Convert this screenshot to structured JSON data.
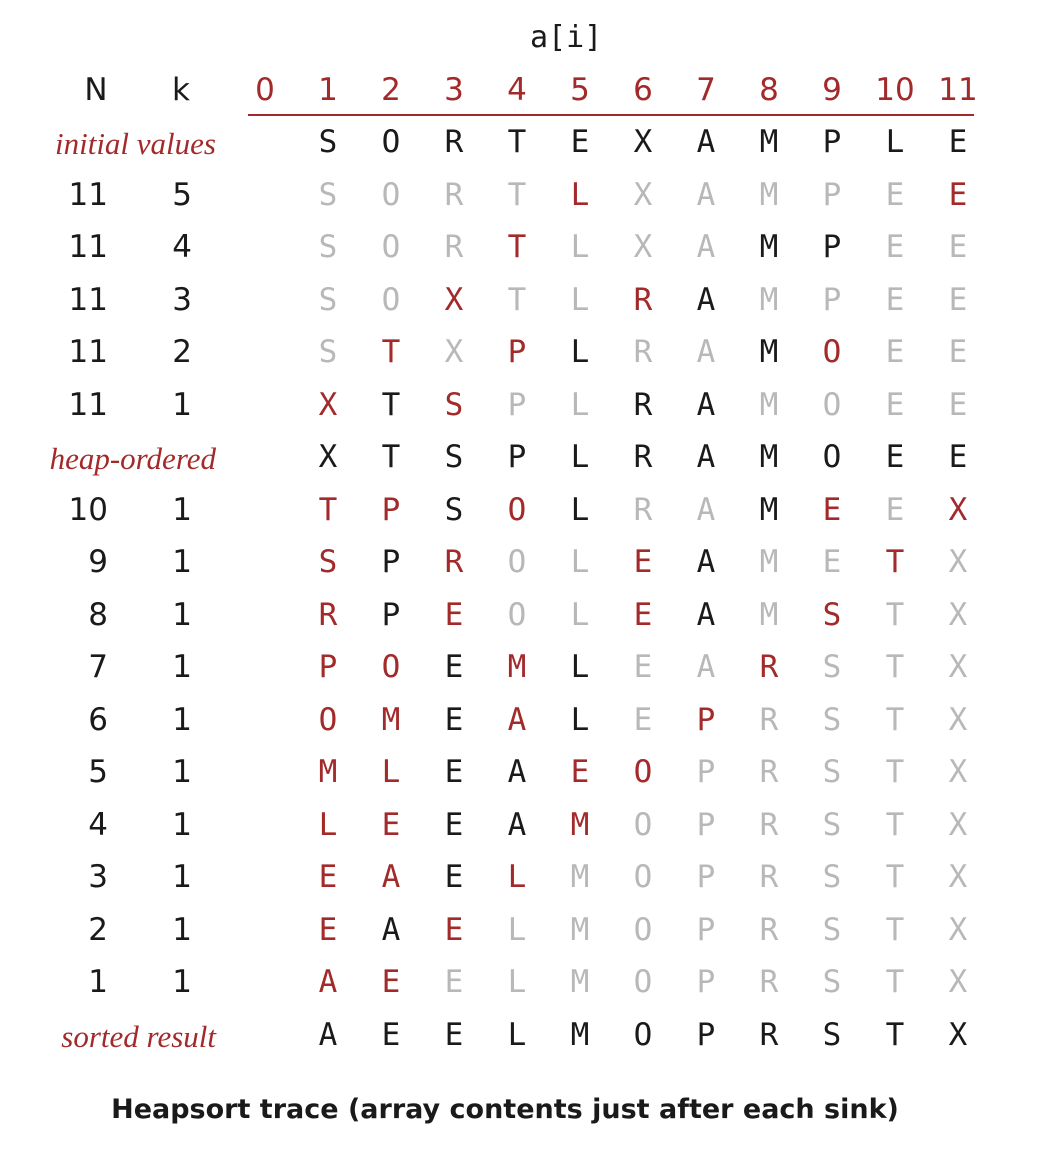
{
  "title": "a[i]",
  "headers": {
    "n": "N",
    "k": "k"
  },
  "indices": [
    "0",
    "1",
    "2",
    "3",
    "4",
    "5",
    "6",
    "7",
    "8",
    "9",
    "10",
    "11"
  ],
  "rows": [
    {
      "label": "initial values",
      "n": "",
      "k": "",
      "cells": [
        "S",
        "O",
        "R",
        "T",
        "E",
        "X",
        "A",
        "M",
        "P",
        "L",
        "E"
      ],
      "styles": "bbbbbbbbbbb"
    },
    {
      "label": "",
      "n": "11",
      "k": "5",
      "cells": [
        "S",
        "O",
        "R",
        "T",
        "L",
        "X",
        "A",
        "M",
        "P",
        "E",
        "E"
      ],
      "styles": "ggggrgggg rb"
    },
    {
      "label": "",
      "n": "11",
      "k": "4",
      "cells": [
        "S",
        "O",
        "R",
        "T",
        "L",
        "X",
        "A",
        "M",
        "P",
        "E",
        "E"
      ],
      "styles": "gggrgggbbgg"
    },
    {
      "label": "",
      "n": "11",
      "k": "3",
      "cells": [
        "S",
        "O",
        "X",
        "T",
        "L",
        "R",
        "A",
        "M",
        "P",
        "E",
        "E"
      ],
      "styles": "ggrggrbgggg"
    },
    {
      "label": "",
      "n": "11",
      "k": "2",
      "cells": [
        "S",
        "T",
        "X",
        "P",
        "L",
        "R",
        "A",
        "M",
        "O",
        "E",
        "E"
      ],
      "styles": "grgrbggbrgg"
    },
    {
      "label": "",
      "n": "11",
      "k": "1",
      "cells": [
        "X",
        "T",
        "S",
        "P",
        "L",
        "R",
        "A",
        "M",
        "O",
        "E",
        "E"
      ],
      "styles": "rbrggbbgggg"
    },
    {
      "label": "heap-ordered",
      "n": "",
      "k": "",
      "cells": [
        "X",
        "T",
        "S",
        "P",
        "L",
        "R",
        "A",
        "M",
        "O",
        "E",
        "E"
      ],
      "styles": "bbbbbbbbbbb"
    },
    {
      "label": "",
      "n": "10",
      "k": "1",
      "cells": [
        "T",
        "P",
        "S",
        "O",
        "L",
        "R",
        "A",
        "M",
        "E",
        "E",
        "X"
      ],
      "styles": "rrbrbggbrgr"
    },
    {
      "label": "",
      "n": "9",
      "k": "1",
      "cells": [
        "S",
        "P",
        "R",
        "O",
        "L",
        "E",
        "A",
        "M",
        "E",
        "T",
        "X"
      ],
      "styles": "rbrggrbggrg"
    },
    {
      "label": "",
      "n": "8",
      "k": "1",
      "cells": [
        "R",
        "P",
        "E",
        "O",
        "L",
        "E",
        "A",
        "M",
        "S",
        "T",
        "X"
      ],
      "styles": "rbrggrbgrgg"
    },
    {
      "label": "",
      "n": "7",
      "k": "1",
      "cells": [
        "P",
        "O",
        "E",
        "M",
        "L",
        "E",
        "A",
        "R",
        "S",
        "T",
        "X"
      ],
      "styles": "rrbrbggrggg"
    },
    {
      "label": "",
      "n": "6",
      "k": "1",
      "cells": [
        "O",
        "M",
        "E",
        "A",
        "L",
        "E",
        "P",
        "R",
        "S",
        "T",
        "X"
      ],
      "styles": "rrbrbgrgggg"
    },
    {
      "label": "",
      "n": "5",
      "k": "1",
      "cells": [
        "M",
        "L",
        "E",
        "A",
        "E",
        "O",
        "P",
        "R",
        "S",
        "T",
        "X"
      ],
      "styles": "rrbbrrggggg"
    },
    {
      "label": "",
      "n": "4",
      "k": "1",
      "cells": [
        "L",
        "E",
        "E",
        "A",
        "M",
        "O",
        "P",
        "R",
        "S",
        "T",
        "X"
      ],
      "styles": "rrbbrgggggg"
    },
    {
      "label": "",
      "n": "3",
      "k": "1",
      "cells": [
        "E",
        "A",
        "E",
        "L",
        "M",
        "O",
        "P",
        "R",
        "S",
        "T",
        "X"
      ],
      "styles": "rrbrggggggg"
    },
    {
      "label": "",
      "n": "2",
      "k": "1",
      "cells": [
        "E",
        "A",
        "E",
        "L",
        "M",
        "O",
        "P",
        "R",
        "S",
        "T",
        "X"
      ],
      "styles": "rbrgggggggg"
    },
    {
      "label": "",
      "n": "1",
      "k": "1",
      "cells": [
        "A",
        "E",
        "E",
        "L",
        "M",
        "O",
        "P",
        "R",
        "S",
        "T",
        "X"
      ],
      "styles": "rrggggggggg"
    },
    {
      "label": "sorted result",
      "n": "",
      "k": "",
      "cells": [
        "A",
        "E",
        "E",
        "L",
        "M",
        "O",
        "P",
        "R",
        "S",
        "T",
        "X"
      ],
      "styles": "bbbbbbbbbbb"
    }
  ],
  "caption": "Heapsort trace (array contents just after each sink)",
  "colors": {
    "ink": "#1a1a1a",
    "accent": "#a32a2a",
    "faded": "#b8b8b8"
  }
}
